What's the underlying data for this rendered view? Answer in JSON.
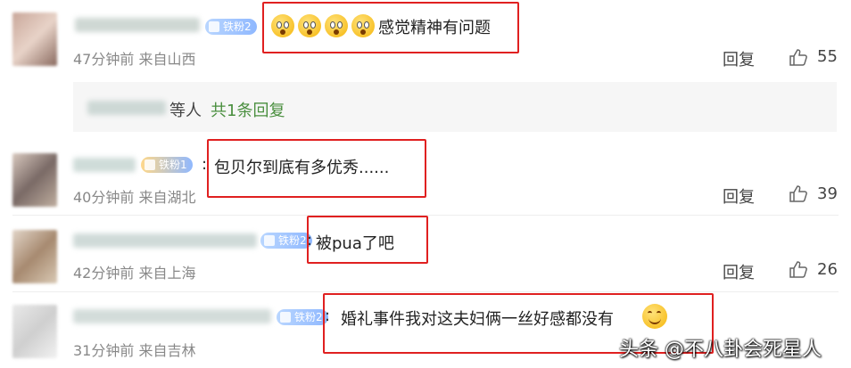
{
  "comments": [
    {
      "badge": "铁粉2",
      "text": "感觉精神有问题",
      "time": "47分钟前",
      "location": "来自山西",
      "reply_label": "回复",
      "likes": "55"
    },
    {
      "badge": "铁粉1",
      "text": "包贝尔到底有多优秀......",
      "time": "40分钟前",
      "location": "来自湖北",
      "reply_label": "回复",
      "likes": "39"
    },
    {
      "badge": "铁粉2",
      "text": "被pua了吧",
      "time": "42分钟前",
      "location": "来自上海",
      "reply_label": "回复",
      "likes": "26"
    },
    {
      "badge": "铁粉2",
      "text": "婚礼事件我对这夫妇俩一丝好感都没有",
      "time": "31分钟前",
      "location": "来自吉林"
    }
  ],
  "sub_reply": {
    "prefix": "等人",
    "link": "共1条回复"
  },
  "watermark": "头条 @不八卦会死星人",
  "colors": {
    "highlight_box": "#e02020",
    "link": "#4a8f3f",
    "badge": "#8fb8ff"
  },
  "icons": [
    "thumb-up-icon",
    "wonder-emoji-icon",
    "smile-emoji-icon",
    "fan-badge-icon"
  ]
}
